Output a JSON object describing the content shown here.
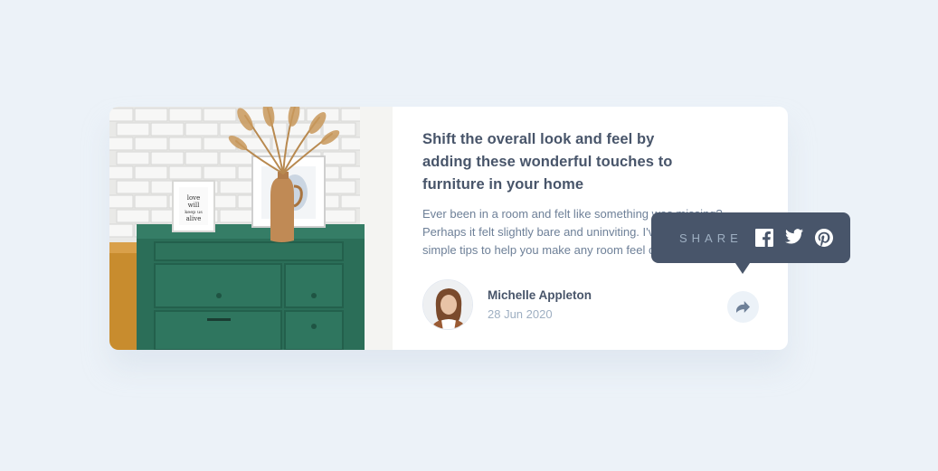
{
  "article": {
    "title": "Shift the overall look and feel by adding these wonderful touches to furniture in your home",
    "excerpt_lines": [
      "Ever been in a room and felt like something was missing?",
      "Perhaps it felt slightly bare and uninviting. I've got some",
      "simple tips to help you make any room feel complete."
    ]
  },
  "author": {
    "name": "Michelle Appleton",
    "date": "28 Jun 2020"
  },
  "share": {
    "label": "SHARE",
    "icons": [
      "facebook-icon",
      "twitter-icon",
      "pinterest-icon"
    ]
  },
  "image": {
    "frame_text": [
      "love",
      "will",
      "keep us",
      "alive"
    ]
  },
  "colors": {
    "background": "#ecf2f8",
    "card": "#ffffff",
    "dark_blue": "#48556a",
    "grayish_blue": "#6e8098",
    "light_grayish_blue": "#9eafc2"
  }
}
